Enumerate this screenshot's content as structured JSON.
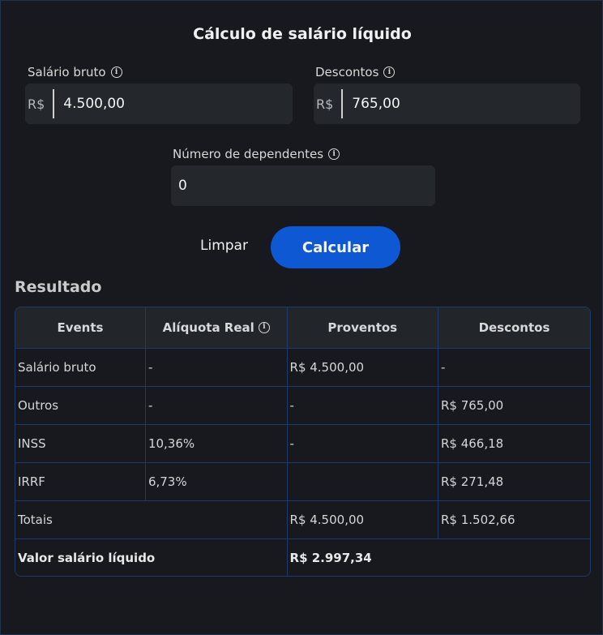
{
  "title": "Cálculo de salário líquido",
  "fields": {
    "salario_bruto": {
      "label": "Salário bruto",
      "prefix": "R$",
      "value": "4.500,00"
    },
    "descontos": {
      "label": "Descontos",
      "prefix": "R$",
      "value": "765,00"
    },
    "dependentes": {
      "label": "Número de dependentes",
      "value": "0"
    }
  },
  "info_icon": "i",
  "buttons": {
    "clear": "Limpar",
    "calculate": "Calcular"
  },
  "result": {
    "title": "Resultado",
    "headers": [
      "Events",
      "Alíquota Real",
      "Proventos",
      "Descontos"
    ],
    "rows": [
      [
        "Salário bruto",
        "-",
        "R$ 4.500,00",
        "-"
      ],
      [
        "Outros",
        "-",
        "-",
        "R$ 765,00"
      ],
      [
        "INSS",
        "10,36%",
        "-",
        "R$ 466,18"
      ],
      [
        "IRRF",
        "6,73%",
        "",
        "R$ 271,48"
      ]
    ],
    "totals": {
      "label": "Totais",
      "proventos": "R$ 4.500,00",
      "descontos": "R$ 1.502,66"
    },
    "net": {
      "label": "Valor salário líquido",
      "value": "R$ 2.997,34"
    }
  },
  "colors": {
    "accent": "#0e58d4",
    "table_border": "#1d3a6a",
    "background": "#17191e"
  }
}
